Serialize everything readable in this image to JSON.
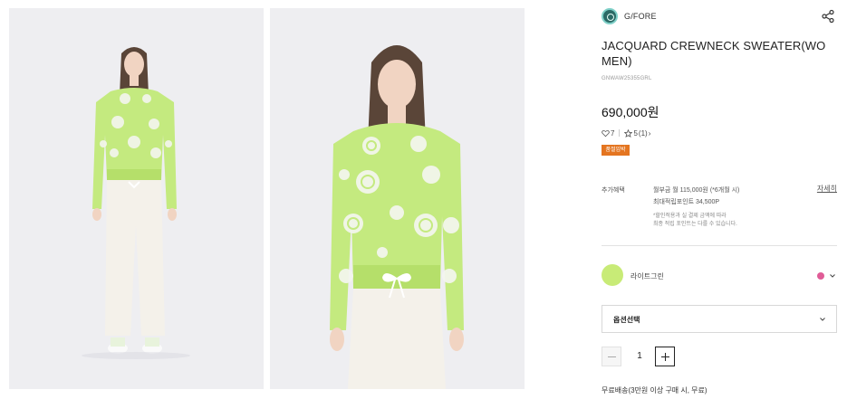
{
  "brand": {
    "name": "G/FORE",
    "logo_icon": "brand-logo-icon"
  },
  "product": {
    "title": "JACQUARD CREWNECK SWEATER(WOMEN)",
    "code": "GNWAW25355GRL",
    "price": "690,000원",
    "likes": "7",
    "rating": "5",
    "reviews": "(1)",
    "badge": "품절임박"
  },
  "benefits": {
    "label": "추가혜택",
    "line1": "월부금 월 115,000원 (*6개월 시)",
    "line2": "최대적립포인트 34,500P",
    "note1": "*할인적용과 실 결제 금액에 따라",
    "note2": "최종 적립 포인트는 다를 수 있습니다.",
    "detail": "자세히"
  },
  "color": {
    "name": "라이트그린",
    "swatch": "#c8eb77",
    "alt_dot": "#e05c97"
  },
  "option": {
    "label": "옵션선택"
  },
  "quantity": {
    "value": "1"
  },
  "shipping": "무료배송(3만원 이상 구매 시, 무료)",
  "colors": {
    "sweater": "#c4ea7f",
    "pants": "#f4f1ea",
    "badge": "#e47520"
  }
}
